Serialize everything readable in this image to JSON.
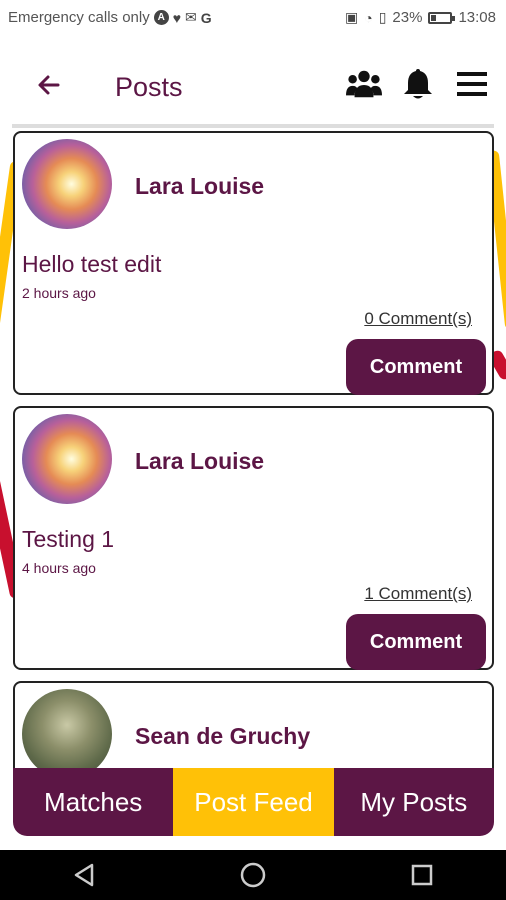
{
  "status_bar": {
    "carrier": "Emergency calls only",
    "battery": "23%",
    "time": "13:08",
    "battery_level": 0.23
  },
  "header": {
    "title": "Posts"
  },
  "posts": [
    {
      "author": "Lara Louise",
      "text": "Hello test edit",
      "time": "2 hours ago",
      "comments": "0 Comment(s)",
      "button": "Comment"
    },
    {
      "author": "Lara Louise",
      "text": "Testing 1",
      "time": "4 hours ago",
      "comments": "1 Comment(s)",
      "button": "Comment"
    },
    {
      "author": "Sean de Gruchy"
    }
  ],
  "tabs": {
    "items": [
      {
        "label": "Matches"
      },
      {
        "label": "Post Feed"
      },
      {
        "label": "My Posts"
      }
    ],
    "active": "Post Feed"
  },
  "colors": {
    "primary": "#5c1645",
    "accent": "#ffc107"
  }
}
